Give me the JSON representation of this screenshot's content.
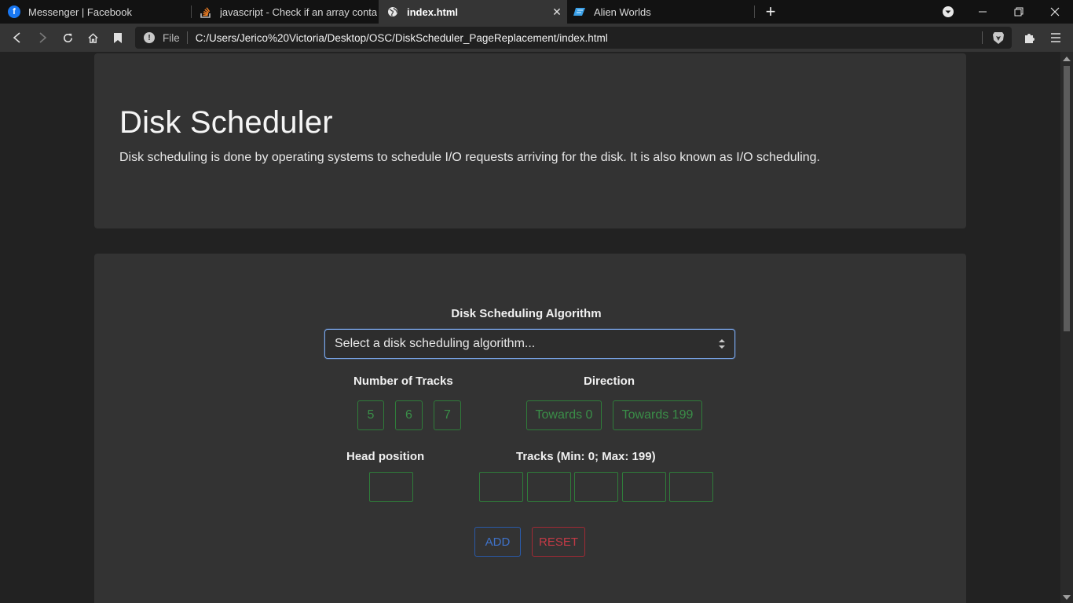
{
  "browser": {
    "tabs": [
      {
        "title": "Messenger | Facebook",
        "icon": "facebook-icon"
      },
      {
        "title": "javascript - Check if an array contains",
        "icon": "stackoverflow-icon"
      },
      {
        "title": "index.html",
        "icon": "globe-icon"
      },
      {
        "title": "Alien Worlds",
        "icon": "alien-worlds-icon"
      }
    ],
    "address": {
      "scheme_label": "File",
      "url": "C:/Users/Jerico%20Victoria/Desktop/OSC/DiskScheduler_PageReplacement/index.html"
    }
  },
  "header": {
    "title": "Disk Scheduler",
    "description": "Disk scheduling is done by operating systems to schedule I/O requests arriving for the disk. It is also known as I/O scheduling."
  },
  "form": {
    "algorithm_label": "Disk Scheduling Algorithm",
    "algorithm_placeholder": "Select a disk scheduling algorithm...",
    "tracks_count_label": "Number of Tracks",
    "tracks_count_options": [
      "5",
      "6",
      "7"
    ],
    "direction_label": "Direction",
    "direction_options": [
      "Towards 0",
      "Towards 199"
    ],
    "head_label": "Head position",
    "tracks_label": "Tracks (Min: 0; Max: 199)",
    "add_label": "ADD",
    "reset_label": "RESET"
  },
  "colors": {
    "success": "#3a8e48",
    "primary": "#3f72c9",
    "danger": "#c23a46",
    "card": "#333333",
    "background": "#222222"
  }
}
